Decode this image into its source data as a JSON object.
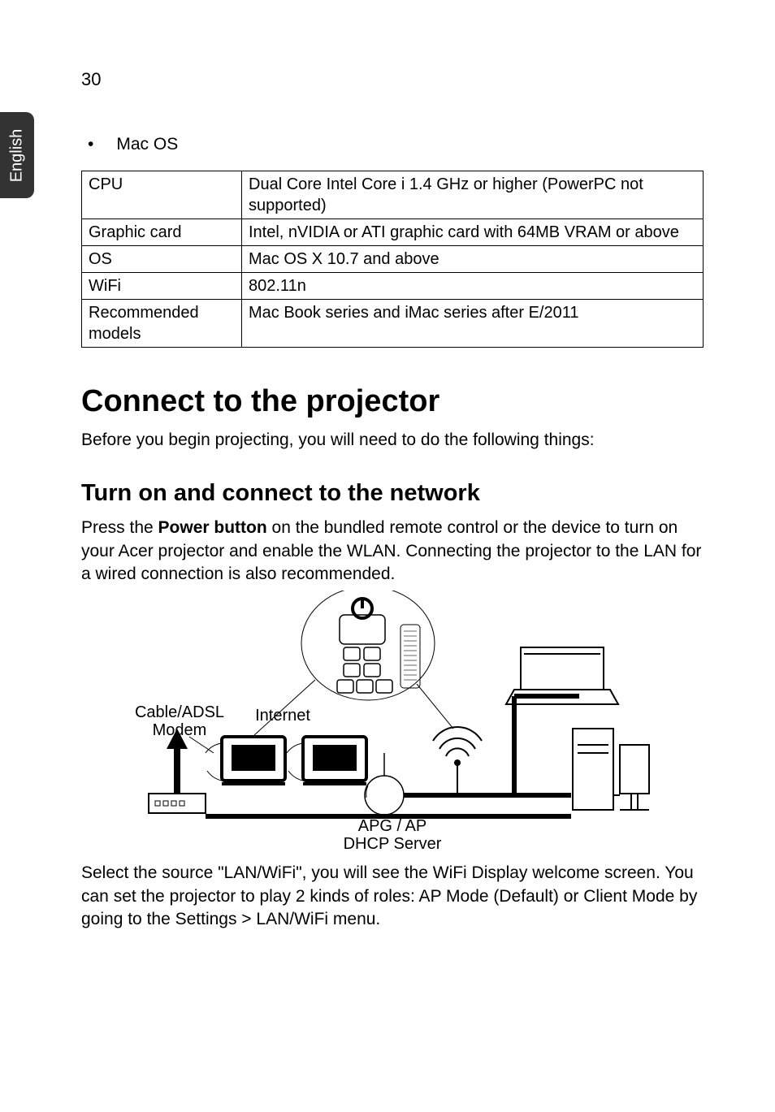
{
  "pagenum": "30",
  "sidetab": "English",
  "bullet": "Mac OS",
  "specs": {
    "cpu_label": "CPU",
    "cpu_val": "Dual Core Intel Core i 1.4 GHz or higher (PowerPC not supported)",
    "gpu_label": "Graphic card",
    "gpu_val": "Intel, nVIDIA or ATI graphic card with 64MB VRAM or above",
    "os_label": "OS",
    "os_val": "Mac OS X 10.7 and above",
    "wifi_label": "WiFi",
    "wifi_val": "802.11n",
    "rec_label": "Recommended models",
    "rec_val": "Mac Book series and iMac series after E/2011"
  },
  "h1": "Connect to the projector",
  "p_intro": "Before you begin projecting, you will need to do the following things:",
  "h2": "Turn on and connect to the network",
  "p_turn_prefix": "Press the ",
  "p_turn_bold": "Power button",
  "p_turn_rest": " on the bundled remote control or the device to turn on your Acer projector and enable the WLAN. Connecting the projector to the LAN for a wired connection is also recommended.",
  "fig": {
    "cable": "Cable/ADSL",
    "modem": "Modem",
    "internet": "Internet",
    "apg": "APG / AP",
    "dhcp": "DHCP Server"
  },
  "p_select": "Select the source \"LAN/WiFi\", you will see the WiFi Display welcome screen. You can set the projector to play 2 kinds of roles: AP Mode (Default) or Client Mode by going to the Settings > LAN/WiFi menu."
}
